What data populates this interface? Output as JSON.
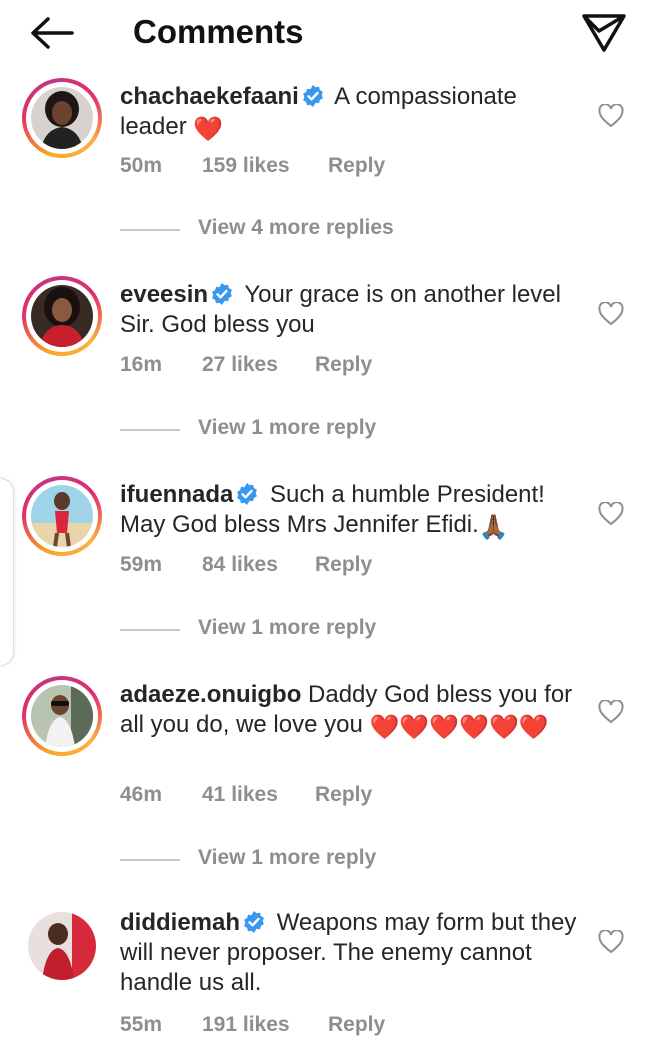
{
  "header": {
    "title": "Comments"
  },
  "comments": [
    {
      "username": "chachaekefaani",
      "verified": true,
      "text": "A compassionate leader",
      "emoji": "❤️",
      "time": "50m",
      "likes": "159 likes",
      "reply": "Reply",
      "view_replies": "View 4 more replies"
    },
    {
      "username": "eveesin",
      "verified": true,
      "text": "Your grace is on another level Sir. God bless you",
      "time": "16m",
      "likes": "27 likes",
      "reply": "Reply",
      "view_replies": "View 1 more reply"
    },
    {
      "username": "ifuennada",
      "verified": true,
      "text": "Such a humble President! May God bless Mrs Jennifer Efidi.",
      "emoji": "🙏🏾",
      "time": "59m",
      "likes": "84 likes",
      "reply": "Reply",
      "view_replies": "View 1 more reply"
    },
    {
      "username": "adaeze.onuigbo",
      "verified": false,
      "text": "Daddy God bless you for all you do, we love you",
      "emoji": "❤️❤️❤️❤️❤️❤️",
      "time": "46m",
      "likes": "41 likes",
      "reply": "Reply",
      "view_replies": "View 1 more reply"
    },
    {
      "username": "diddiemah",
      "verified": true,
      "text": "Weapons may form but they will never proposer. The enemy cannot handle us all.",
      "time": "55m",
      "likes": "191 likes",
      "reply": "Reply"
    }
  ],
  "colors": {
    "verified": "#3897f0",
    "heart_emoji": "#e0202b",
    "muted_text": "#8e8e8e",
    "ring_gradient": [
      "#f9a825",
      "#e1306c",
      "#c13584"
    ]
  }
}
